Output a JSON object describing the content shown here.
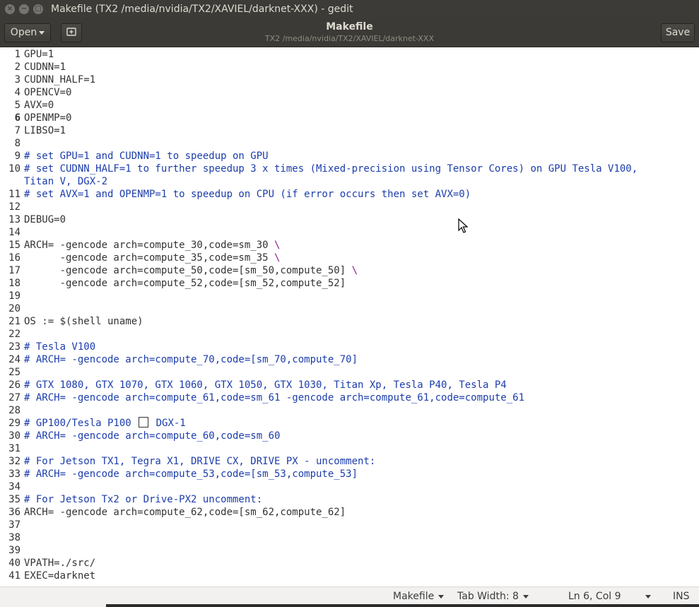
{
  "window": {
    "title": "Makefile (TX2 /media/nvidia/TX2/XAVIEL/darknet-XXX) - gedit",
    "close_glyph": "×",
    "minimize_glyph": "−",
    "maximize_glyph": "□"
  },
  "header": {
    "open_label": "Open",
    "doc_title": "Makefile",
    "doc_path": "TX2 /media/nvidia/TX2/XAVIEL/darknet-XXX",
    "save_label": "Save"
  },
  "editor": {
    "current_line": 6,
    "line_numbers": [
      "1",
      "2",
      "3",
      "4",
      "5",
      "6",
      "7",
      "8",
      "9",
      "10",
      "",
      "11",
      "12",
      "13",
      "14",
      "15",
      "16",
      "17",
      "18",
      "19",
      "20",
      "21",
      "22",
      "23",
      "24",
      "25",
      "26",
      "27",
      "28",
      "29",
      "30",
      "31",
      "32",
      "33",
      "34",
      "35",
      "36",
      "37",
      "38",
      "39",
      "40",
      "41"
    ],
    "lines": [
      "GPU=1",
      "CUDNN=1",
      "CUDNN_HALF=1",
      "OPENCV=0",
      "AVX=0",
      "OPENMP=0",
      "LIBSO=1",
      "",
      "# set GPU=1 and CUDNN=1 to speedup on GPU",
      "# set CUDNN_HALF=1 to further speedup 3 x times (Mixed-precision using Tensor Cores) on GPU Tesla V100,",
      "Titan V, DGX-2",
      "# set AVX=1 and OPENMP=1 to speedup on CPU (if error occurs then set AVX=0)",
      "",
      "DEBUG=0",
      "",
      "ARCH= -gencode arch=compute_30,code=sm_30 ",
      "      -gencode arch=compute_35,code=sm_35 ",
      "      -gencode arch=compute_50,code=[sm_50,compute_50] ",
      "      -gencode arch=compute_52,code=[sm_52,compute_52]",
      "",
      "",
      "OS := $(shell uname)",
      "",
      "# Tesla V100",
      "# ARCH= -gencode arch=compute_70,code=[sm_70,compute_70]",
      "",
      "# GTX 1080, GTX 1070, GTX 1060, GTX 1050, GTX 1030, Titan Xp, Tesla P40, Tesla P4",
      "# ARCH= -gencode arch=compute_61,code=sm_61 -gencode arch=compute_61,code=compute_61",
      "",
      "# GP100/Tesla P100 ",
      "# ARCH= -gencode arch=compute_60,code=sm_60",
      "",
      "# For Jetson TX1, Tegra X1, DRIVE CX, DRIVE PX - uncomment:",
      "# ARCH= -gencode arch=compute_53,code=[sm_53,compute_53]",
      "",
      "# For Jetson Tx2 or Drive-PX2 uncomment:",
      "ARCH= -gencode arch=compute_62,code=[sm_62,compute_62]",
      "",
      "",
      "",
      "VPATH=./src/",
      "EXEC=darknet"
    ],
    "line29_suffix": " DGX-1",
    "backslash": "\\"
  },
  "statusbar": {
    "language": "Makefile",
    "tab_width": "Tab Width: 8",
    "position": "Ln 6, Col 9",
    "mode": "INS"
  }
}
